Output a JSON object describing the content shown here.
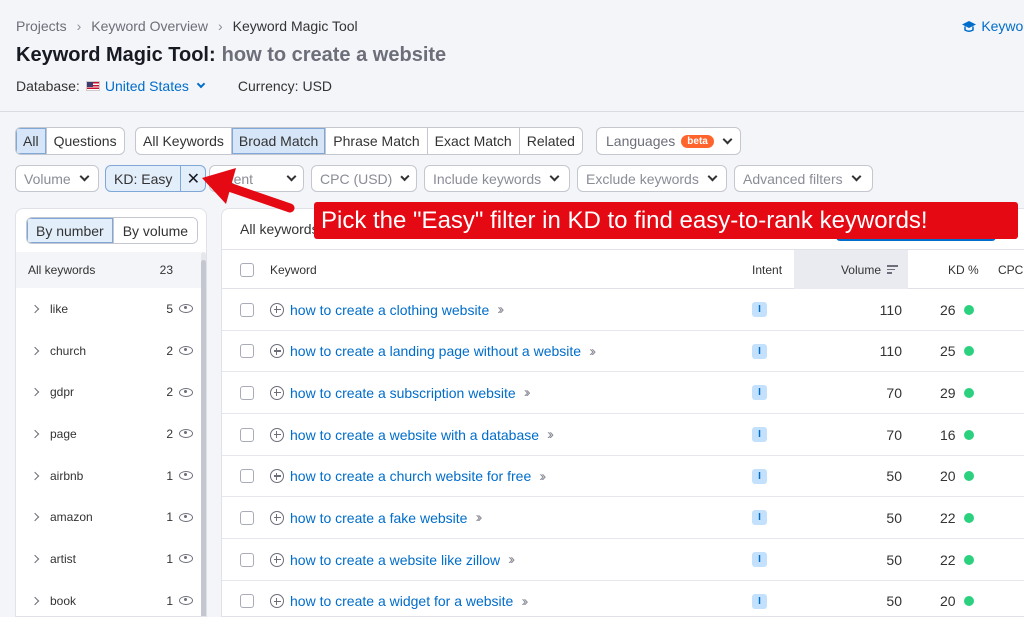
{
  "breadcrumb": [
    "Projects",
    "Keyword Overview",
    "Keyword Magic Tool"
  ],
  "help_link": "Keywor",
  "title": {
    "tool": "Keyword Magic Tool:",
    "query": "how to create a website"
  },
  "database": {
    "label": "Database:",
    "country": "United States",
    "currency": "Currency: USD"
  },
  "tabs_type": [
    "All",
    "Questions"
  ],
  "tabs_match": [
    "All Keywords",
    "Broad Match",
    "Phrase Match",
    "Exact Match",
    "Related"
  ],
  "languages": {
    "label": "Languages",
    "badge": "beta"
  },
  "filters": {
    "volume": "Volume",
    "kd_chip": "KD: Easy",
    "kd_remove": "✕",
    "intent": "Intent",
    "cpc": "CPC (USD)",
    "include": "Include keywords",
    "exclude": "Exclude keywords",
    "advanced": "Advanced filters"
  },
  "callout": "Pick the \"Easy\" filter in KD to find easy-to-rank keywords!",
  "left_panel": {
    "toggle": [
      "By number",
      "By volume"
    ],
    "all_label": "All keywords",
    "all_count": "23",
    "groups": [
      {
        "name": "like",
        "count": "5"
      },
      {
        "name": "church",
        "count": "2"
      },
      {
        "name": "gdpr",
        "count": "2"
      },
      {
        "name": "page",
        "count": "2"
      },
      {
        "name": "airbnb",
        "count": "1"
      },
      {
        "name": "amazon",
        "count": "1"
      },
      {
        "name": "artist",
        "count": "1"
      },
      {
        "name": "book",
        "count": "1"
      }
    ]
  },
  "table": {
    "all_keywords_label": "All keywords",
    "headers": {
      "keyword": "Keyword",
      "intent": "Intent",
      "volume": "Volume",
      "kd": "KD %",
      "cpc": "CPC"
    },
    "rows": [
      {
        "keyword": "how to create a clothing website",
        "intent": "I",
        "volume": "110",
        "kd": "26"
      },
      {
        "keyword": "how to create a landing page without a website",
        "intent": "I",
        "volume": "110",
        "kd": "25"
      },
      {
        "keyword": "how to create a subscription website",
        "intent": "I",
        "volume": "70",
        "kd": "29"
      },
      {
        "keyword": "how to create a website with a database",
        "intent": "I",
        "volume": "70",
        "kd": "16"
      },
      {
        "keyword": "how to create a church website for free",
        "intent": "I",
        "volume": "50",
        "kd": "20"
      },
      {
        "keyword": "how to create a fake website",
        "intent": "I",
        "volume": "50",
        "kd": "22"
      },
      {
        "keyword": "how to create a website like zillow",
        "intent": "I",
        "volume": "50",
        "kd": "22"
      },
      {
        "keyword": "how to create a widget for a website",
        "intent": "I",
        "volume": "50",
        "kd": "20"
      }
    ]
  },
  "colors": {
    "accent": "#006dca",
    "callout": "#e50914",
    "kd_easy": "#2bd17e",
    "beta": "#ff642d"
  }
}
